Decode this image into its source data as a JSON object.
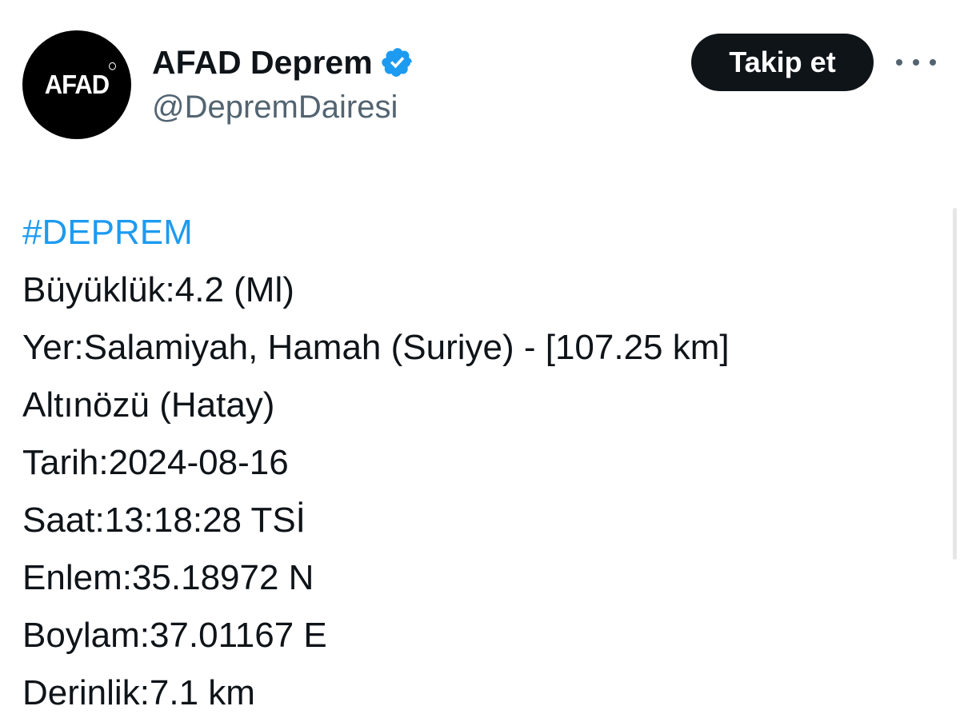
{
  "author": {
    "avatar_text": "AFAD",
    "display_name": "AFAD Deprem",
    "handle": "@DepremDairesi",
    "verified": true
  },
  "actions": {
    "follow_label": "Takip et"
  },
  "colors": {
    "accent": "#1d9bf0",
    "text": "#0f1419",
    "secondary_text": "#536471",
    "button_bg": "#0f1419"
  },
  "tweet": {
    "hashtag": "#DEPREM",
    "lines": [
      "Büyüklük:4.2 (Ml)",
      "Yer:Salamiyah, Hamah (Suriye) - [107.25 km]",
      "Altınözü (Hatay)",
      "Tarih:2024-08-16",
      "Saat:13:18:28 TSİ",
      "Enlem:35.18972 N",
      "Boylam:37.01167 E",
      "Derinlik:7.1 km"
    ]
  }
}
